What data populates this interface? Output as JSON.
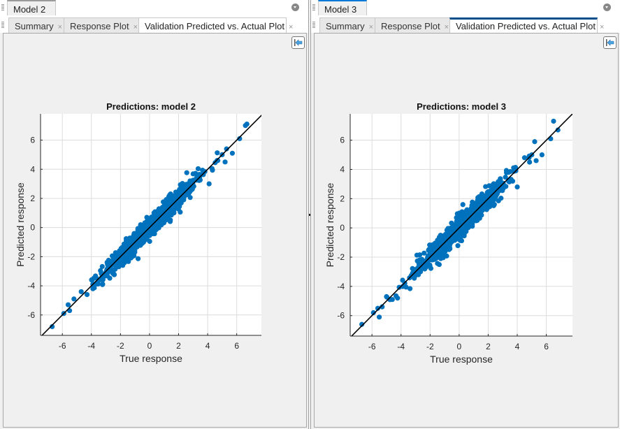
{
  "panels": [
    {
      "doc_tab": "Model 2",
      "tabs": [
        {
          "label": "Summary",
          "close": "×"
        },
        {
          "label": "Response Plot",
          "close": "×"
        },
        {
          "label": "Validation Predicted vs. Actual Plot",
          "close": "×"
        }
      ],
      "selected_tab": "Validation Predicted vs. Actual Plot",
      "icons": {
        "menu": "panel-menu-icon",
        "dock": "undock-arrow-icon"
      }
    },
    {
      "doc_tab": "Model 3",
      "tabs": [
        {
          "label": "Summary",
          "close": "×"
        },
        {
          "label": "Response Plot",
          "close": "×"
        },
        {
          "label": "Validation Predicted vs. Actual Plot",
          "close": "×"
        }
      ],
      "selected_tab": "Validation Predicted vs. Actual Plot",
      "icons": {
        "menu": "panel-menu-icon",
        "dock": "undock-arrow-icon"
      }
    }
  ],
  "colors": {
    "points": "#0072bd",
    "line": "#000000",
    "grid": "#dcdcdc",
    "active_tab_accent": "#0a4f8c"
  },
  "chart_data": [
    {
      "type": "scatter",
      "title": "Predictions: model 2",
      "xlabel": "True response",
      "ylabel": "Predicted response",
      "xlim": [
        -7.5,
        7.7
      ],
      "ylim": [
        -7.4,
        7.8
      ],
      "xticks": [
        -6,
        -4,
        -2,
        0,
        2,
        4,
        6
      ],
      "yticks": [
        -6,
        -4,
        -2,
        0,
        2,
        4,
        6
      ],
      "grid": true,
      "reference_line": "y = x",
      "point_cloud": {
        "slope": 1.0,
        "spread": 0.35,
        "x_range": [
          -5.2,
          5.7
        ],
        "count": 900
      },
      "notable_points": [
        [
          -6.7,
          -6.8
        ],
        [
          -5.9,
          -5.9
        ],
        [
          -5.6,
          -5.3
        ],
        [
          -5.5,
          -5.7
        ],
        [
          -5.2,
          -4.9
        ],
        [
          -4.7,
          -4.4
        ],
        [
          -4.3,
          -4.6
        ],
        [
          4.7,
          4.6
        ],
        [
          5.0,
          5.0
        ],
        [
          5.2,
          4.5
        ],
        [
          5.3,
          5.4
        ],
        [
          5.7,
          5.1
        ],
        [
          6.2,
          6.1
        ],
        [
          6.6,
          7.0
        ],
        [
          6.7,
          7.1
        ],
        [
          4.1,
          3.0
        ],
        [
          3.7,
          3.8
        ]
      ]
    },
    {
      "type": "scatter",
      "title": "Predictions: model 3",
      "xlabel": "True response",
      "ylabel": "Predicted response",
      "xlim": [
        -7.5,
        7.8
      ],
      "ylim": [
        -7.4,
        7.8
      ],
      "xticks": [
        -6,
        -4,
        -2,
        0,
        2,
        4,
        6
      ],
      "yticks": [
        -6,
        -4,
        -2,
        0,
        2,
        4,
        6
      ],
      "grid": true,
      "reference_line": "y = x",
      "point_cloud": {
        "slope": 1.0,
        "spread": 0.38,
        "x_range": [
          -5.0,
          5.4
        ],
        "count": 900
      },
      "notable_points": [
        [
          -6.7,
          -6.6
        ],
        [
          -5.9,
          -5.8
        ],
        [
          -5.6,
          -5.5
        ],
        [
          -5.5,
          -6.1
        ],
        [
          -5.3,
          -5.4
        ],
        [
          -5.0,
          -4.7
        ],
        [
          -4.6,
          -4.9
        ],
        [
          4.0,
          2.8
        ],
        [
          4.5,
          4.8
        ],
        [
          5.0,
          5.0
        ],
        [
          5.2,
          5.9
        ],
        [
          5.3,
          4.6
        ],
        [
          5.7,
          5.0
        ],
        [
          6.3,
          6.1
        ],
        [
          6.5,
          7.3
        ],
        [
          6.8,
          6.7
        ],
        [
          3.4,
          3.8
        ]
      ]
    }
  ]
}
